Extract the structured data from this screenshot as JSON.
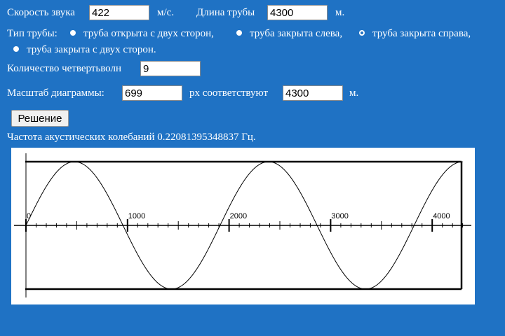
{
  "speed": {
    "label": "Скорость звука",
    "value": "422",
    "unit": "м/с."
  },
  "length": {
    "label": "Длина трубы",
    "value": "4300",
    "unit": "м."
  },
  "pipe_type": {
    "label": "Тип трубы:",
    "options": [
      {
        "label": "труба открыта с двух сторон,",
        "selected": false
      },
      {
        "label": "труба закрыта слева,",
        "selected": false
      },
      {
        "label": "труба закрыта справа,",
        "selected": true
      },
      {
        "label": "труба закрыта с двух сторон.",
        "selected": false
      }
    ]
  },
  "quarter_waves": {
    "label": "Количество четвертьволн",
    "value": "9"
  },
  "scale": {
    "label": "Масштаб диаграммы:",
    "px_value": "699",
    "middle_text": "px соответствуют",
    "m_value": "4300",
    "unit": "м."
  },
  "solve_button": "Решение",
  "result_text": "Частота акустических колебаний 0.22081395348837 Гц.",
  "diagram": {
    "tick_labels": [
      "0",
      "1000",
      "2000",
      "3000",
      "4000"
    ],
    "pipe_length_m": 4300,
    "quarter_waves": 9
  }
}
